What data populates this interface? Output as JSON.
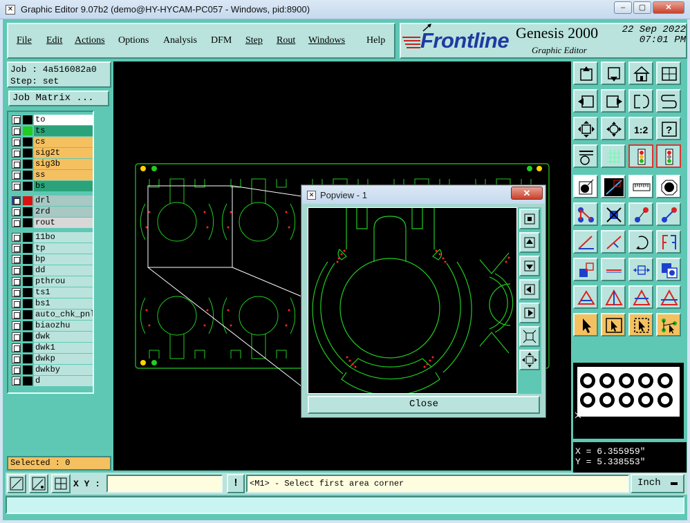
{
  "window": {
    "title": "Graphic Editor 9.07b2 (demo@HY-HYCAM-PC057 - Windows, pid:8900)",
    "minimize": "–",
    "maximize": "▢",
    "close": "✕"
  },
  "menu": [
    {
      "label": "File",
      "underline": true
    },
    {
      "label": "Edit",
      "underline": true
    },
    {
      "label": "Actions",
      "underline": true
    },
    {
      "label": "Options",
      "underline": false
    },
    {
      "label": "Analysis",
      "underline": false
    },
    {
      "label": "DFM",
      "underline": false
    },
    {
      "label": "Step",
      "underline": true
    },
    {
      "label": "Rout",
      "underline": true
    },
    {
      "label": "Windows",
      "underline": true
    },
    {
      "label": "Help",
      "underline": false
    }
  ],
  "branding": {
    "logo": "Frontline",
    "product": "Genesis 2000",
    "subtitle": "Graphic Editor",
    "date": "22 Sep 2022",
    "time": "07:01 PM"
  },
  "job": {
    "job_line": "Job : 4a516082a0",
    "step_line": "Step: set",
    "matrix_button": "Job Matrix ..."
  },
  "layer_groups": [
    [
      {
        "name": "to",
        "swatch": "#000000",
        "bg": "#ffffff"
      },
      {
        "name": "ts",
        "swatch": "#22cc22",
        "bg": "#2aa37a"
      },
      {
        "name": "cs",
        "swatch": "#000000",
        "bg": "#f5c060"
      },
      {
        "name": "sig2t",
        "swatch": "#000000",
        "bg": "#f5c060"
      },
      {
        "name": "sig3b",
        "swatch": "#000000",
        "bg": "#f5c060"
      },
      {
        "name": "ss",
        "swatch": "#000000",
        "bg": "#f5c060"
      },
      {
        "name": "bs",
        "swatch": "#000000",
        "bg": "#2aa37a"
      }
    ],
    [
      {
        "name": "drl",
        "swatch": "#dd1111",
        "bg": "#a8c8c4",
        "active": true
      },
      {
        "name": "2rd",
        "swatch": "#000000",
        "bg": "#a8c8c4"
      },
      {
        "name": "rout",
        "swatch": "#000000",
        "bg": "#d8d8d8"
      }
    ],
    [
      {
        "name": "11bo",
        "swatch": "#000000",
        "bg": "#b9e3dc"
      },
      {
        "name": "tp",
        "swatch": "#000000",
        "bg": "#b9e3dc"
      },
      {
        "name": "bp",
        "swatch": "#000000",
        "bg": "#b9e3dc"
      },
      {
        "name": "dd",
        "swatch": "#000000",
        "bg": "#b9e3dc"
      },
      {
        "name": "pthrou",
        "swatch": "#000000",
        "bg": "#b9e3dc"
      },
      {
        "name": "ts1",
        "swatch": "#000000",
        "bg": "#b9e3dc"
      },
      {
        "name": "bs1",
        "swatch": "#000000",
        "bg": "#b9e3dc"
      },
      {
        "name": "auto_chk_pnl",
        "swatch": "#000000",
        "bg": "#b9e3dc"
      },
      {
        "name": "biaozhu",
        "swatch": "#000000",
        "bg": "#b9e3dc"
      },
      {
        "name": "dwk",
        "swatch": "#000000",
        "bg": "#b9e3dc"
      },
      {
        "name": "dwk1",
        "swatch": "#000000",
        "bg": "#b9e3dc"
      },
      {
        "name": "dwkp",
        "swatch": "#000000",
        "bg": "#b9e3dc"
      },
      {
        "name": "dwkby",
        "swatch": "#000000",
        "bg": "#b9e3dc"
      },
      {
        "name": "d",
        "swatch": "#000000",
        "bg": "#b9e3dc"
      }
    ]
  ],
  "selected": "Selected : 0",
  "popview": {
    "title": "Popview - 1",
    "close_x": "✕",
    "close_button": "Close"
  },
  "tool_labels": {
    "one_to_two": "1:2",
    "question": "?"
  },
  "coords": {
    "x": "X = 6.355959\"",
    "y": "Y = 5.338553\""
  },
  "bottom": {
    "xy_label": "X Y :",
    "xy_value": "",
    "excl": "!",
    "prompt": "<M1> - Select first area corner",
    "unit": "Inch"
  },
  "colors": {
    "panel": "#5fc8b4",
    "button": "#b9e3dc",
    "highlight": "#f5c060",
    "trace": "#22cc22",
    "drill": "#ff2222"
  }
}
